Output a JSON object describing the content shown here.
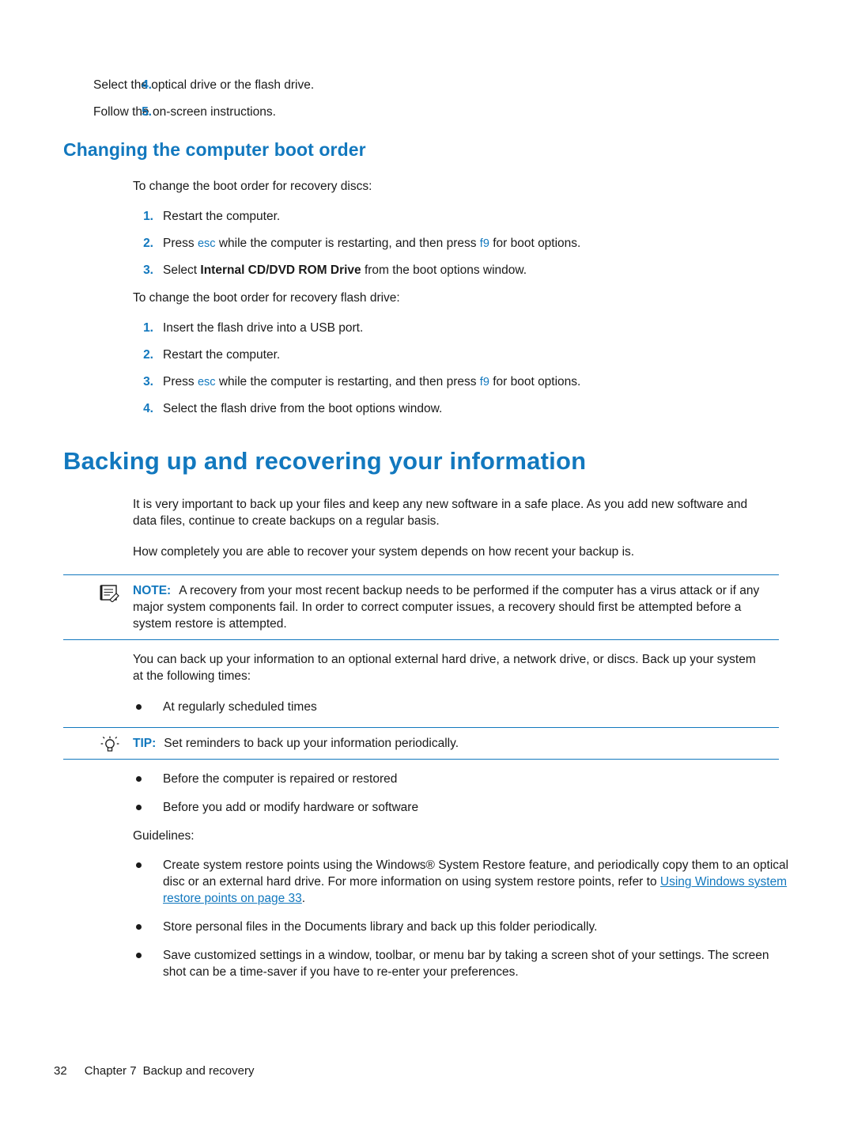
{
  "top_list": {
    "items": [
      {
        "num": "4.",
        "text": "Select the optical drive or the flash drive."
      },
      {
        "num": "5.",
        "text": "Follow the on-screen instructions."
      }
    ]
  },
  "section": {
    "title": "Changing the computer boot order",
    "intro_discs": "To change the boot order for recovery discs:",
    "discs_steps": [
      {
        "num": "1.",
        "text": "Restart the computer."
      },
      {
        "num": "2.",
        "pre": "Press ",
        "key1": "esc",
        "mid": " while the computer is restarting, and then press ",
        "key2": "f9",
        "post": " for boot options."
      },
      {
        "num": "3.",
        "pre": "Select ",
        "bold": "Internal CD/DVD ROM Drive",
        "post": " from the boot options window."
      }
    ],
    "intro_flash": "To change the boot order for recovery flash drive:",
    "flash_steps": [
      {
        "num": "1.",
        "text": "Insert the flash drive into a USB port."
      },
      {
        "num": "2.",
        "text": "Restart the computer."
      },
      {
        "num": "3.",
        "pre": "Press ",
        "key1": "esc",
        "mid": " while the computer is restarting, and then press ",
        "key2": "f9",
        "post": " for boot options."
      },
      {
        "num": "4.",
        "text": "Select the flash drive from the boot options window."
      }
    ]
  },
  "chapter": {
    "title": "Backing up and recovering your information",
    "para1": "It is very important to back up your files and keep any new software in a safe place. As you add new software and data files, continue to create backups on a regular basis.",
    "para2": "How completely you are able to recover your system depends on how recent your backup is.",
    "note": {
      "label": "NOTE:",
      "icon": "note-icon",
      "text": "A recovery from your most recent backup needs to be performed if the computer has a virus attack or if any major system components fail. In order to correct computer issues, a recovery should first be attempted before a system restore is attempted."
    },
    "para3": "You can back up your information to an optional external hard drive, a network drive, or discs. Back up your system at the following times:",
    "times_bullets": [
      "At regularly scheduled times"
    ],
    "tip": {
      "label": "TIP:",
      "icon": "lightbulb-icon",
      "text": "Set reminders to back up your information periodically."
    },
    "times_bullets_after": [
      "Before the computer is repaired or restored",
      "Before you add or modify hardware or software"
    ],
    "guidelines_label": "Guidelines:",
    "guidelines": [
      {
        "pre": "Create system restore points using the Windows® System Restore feature, and periodically copy them to an optical disc or an external hard drive. For more information on using system restore points, refer to ",
        "link": "Using Windows system restore points on page 33",
        "post": "."
      },
      {
        "pre": "Store personal files in the Documents library and back up this folder periodically.",
        "link": "",
        "post": ""
      },
      {
        "pre": "Save customized settings in a window, toolbar, or menu bar by taking a screen shot of your settings. The screen shot can be a time-saver if you have to re-enter your preferences.",
        "link": "",
        "post": ""
      }
    ]
  },
  "footer": {
    "page_number": "32",
    "chapter_label": "Chapter 7",
    "chapter_name": "Backup and recovery"
  },
  "colors": {
    "accent": "#1278be",
    "text": "#1a1a1a"
  }
}
